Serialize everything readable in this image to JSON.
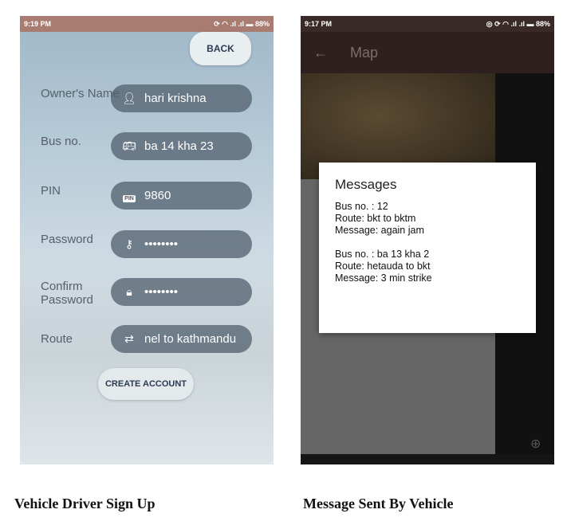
{
  "signup": {
    "status": {
      "time": "9:19 PM",
      "battery": "88%"
    },
    "back_label": "BACK",
    "fields": [
      {
        "label": "Owner's Name",
        "icon": "person-icon",
        "value": "hari krishna"
      },
      {
        "label": "Bus no.",
        "icon": "bus-icon",
        "value": "ba 14 kha 23"
      },
      {
        "label": "PIN",
        "icon": "pin-icon",
        "value": "9860"
      },
      {
        "label": "Password",
        "icon": "key-icon",
        "value": "••••••••"
      },
      {
        "label": "Confirm Password",
        "icon": "lock-icon",
        "value": "••••••••"
      },
      {
        "label": "Route",
        "icon": "swap-icon",
        "value": "nel to kathmandu"
      }
    ],
    "pin_badge": "PIN",
    "create_label": "CREATE ACCOUNT"
  },
  "map": {
    "status": {
      "time": "9:17 PM",
      "battery": "88%"
    },
    "title": "Map",
    "dialog": {
      "title": "Messages",
      "messages": [
        {
          "bus": "Bus no. : 12",
          "route": "Route: bkt to bktm",
          "message": "Message: again jam"
        },
        {
          "bus": "Bus no. : ba 13 kha 2",
          "route": "Route: hetauda to bkt",
          "message": "Message: 3 min strike"
        }
      ]
    }
  },
  "captions": {
    "left": "Vehicle Driver Sign Up",
    "right": "Message Sent By Vehicle"
  }
}
